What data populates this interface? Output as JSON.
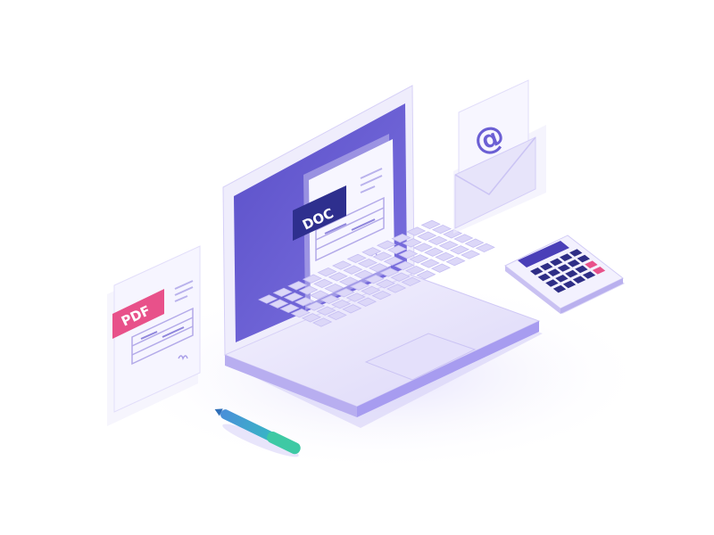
{
  "illustration": {
    "laptop": {
      "screen_document": {
        "tag_label": "DOC"
      }
    },
    "floating_document": {
      "tag_label": "PDF"
    },
    "envelope": {
      "symbol": "@"
    },
    "calculator": {
      "key_rows": 4,
      "key_cols": 5
    },
    "pen": {}
  },
  "colors": {
    "screen": "#6b5fd4",
    "laptop_body": "#e9e6fb",
    "laptop_edge": "#a79cf0",
    "doc_tag": "#2e2f8e",
    "pdf_tag": "#e8518a",
    "calculator_keys": "#2f2e86",
    "calculator_accent": "#e8518a",
    "pen_body": "#4a8fd9",
    "pen_cap": "#3ec9a4",
    "envelope": "#e7e4fa"
  }
}
